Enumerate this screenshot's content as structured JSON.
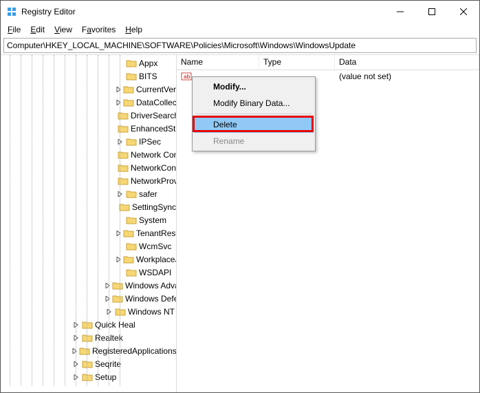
{
  "titlebar": {
    "title": "Registry Editor"
  },
  "menubar": {
    "file": "File",
    "edit": "Edit",
    "view": "View",
    "favorites": "Favorites",
    "help": "Help"
  },
  "addressbar": {
    "path": "Computer\\HKEY_LOCAL_MACHINE\\SOFTWARE\\Policies\\Microsoft\\Windows\\WindowsUpdate"
  },
  "list_header": {
    "name": "Name",
    "type": "Type",
    "data": "Data"
  },
  "list_rows": [
    {
      "name": "",
      "type": "",
      "data": "(value not set)"
    }
  ],
  "context_menu": {
    "modify": "Modify...",
    "modify_binary": "Modify Binary Data...",
    "delete": "Delete",
    "rename": "Rename"
  },
  "tree": [
    {
      "indent": 10,
      "expander": "",
      "label": "Appx"
    },
    {
      "indent": 10,
      "expander": "",
      "label": "BITS"
    },
    {
      "indent": 10,
      "expander": ">",
      "label": "CurrentVersion"
    },
    {
      "indent": 10,
      "expander": ">",
      "label": "DataCollection"
    },
    {
      "indent": 10,
      "expander": "",
      "label": "DriverSearching"
    },
    {
      "indent": 10,
      "expander": "",
      "label": "EnhancedStorageDevices"
    },
    {
      "indent": 10,
      "expander": ">",
      "label": "IPSec"
    },
    {
      "indent": 10,
      "expander": "",
      "label": "Network Connections"
    },
    {
      "indent": 10,
      "expander": "",
      "label": "NetworkConnectivityStatusIndicator"
    },
    {
      "indent": 10,
      "expander": "",
      "label": "NetworkProvider"
    },
    {
      "indent": 10,
      "expander": ">",
      "label": "safer"
    },
    {
      "indent": 10,
      "expander": "",
      "label": "SettingSync"
    },
    {
      "indent": 10,
      "expander": "",
      "label": "System"
    },
    {
      "indent": 10,
      "expander": ">",
      "label": "TenantRestrictions"
    },
    {
      "indent": 10,
      "expander": "",
      "label": "WcmSvc"
    },
    {
      "indent": 10,
      "expander": ">",
      "label": "WorkplaceJoin"
    },
    {
      "indent": 10,
      "expander": "",
      "label": "WSDAPI"
    },
    {
      "indent": 9,
      "expander": ">",
      "label": "Windows Advanced Threat Protection"
    },
    {
      "indent": 9,
      "expander": ">",
      "label": "Windows Defender"
    },
    {
      "indent": 9,
      "expander": ">",
      "label": "Windows NT"
    },
    {
      "indent": 6,
      "expander": ">",
      "label": "Quick Heal"
    },
    {
      "indent": 6,
      "expander": ">",
      "label": "Realtek"
    },
    {
      "indent": 6,
      "expander": ">",
      "label": "RegisteredApplications"
    },
    {
      "indent": 6,
      "expander": ">",
      "label": "Seqrite"
    },
    {
      "indent": 6,
      "expander": ">",
      "label": "Setup"
    }
  ]
}
